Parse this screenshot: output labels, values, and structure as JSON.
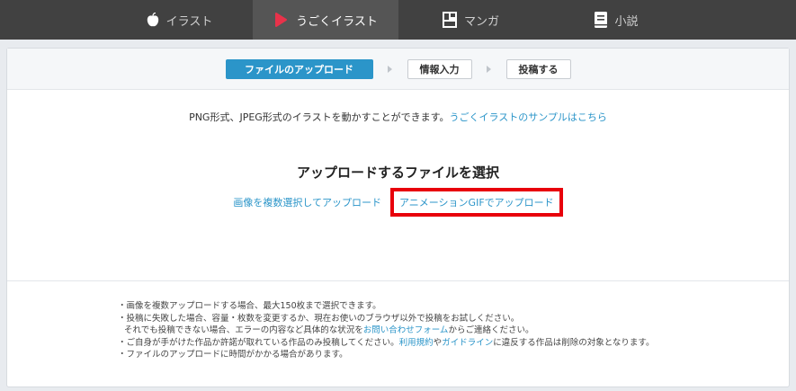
{
  "tabs": [
    {
      "label": "イラスト",
      "icon": "apple-icon"
    },
    {
      "label": "うごくイラスト",
      "icon": "play-icon"
    },
    {
      "label": "マンガ",
      "icon": "manga-icon"
    },
    {
      "label": "小説",
      "icon": "book-icon"
    }
  ],
  "steps": {
    "upload": "ファイルのアップロード",
    "info": "情報入力",
    "post": "投稿する"
  },
  "intro": {
    "text": "PNG形式、JPEG形式のイラストを動かすことができます。",
    "link": "うごくイラストのサンプルはこちら"
  },
  "heading": "アップロードするファイルを選択",
  "options": {
    "multi": "画像を複数選択してアップロード",
    "gif": "アニメーションGIFでアップロード"
  },
  "notes": {
    "line1": "・画像を複数アップロードする場合、最大150枚まで選択できます。",
    "line2": "・投稿に失敗した場合、容量・枚数を変更するか、現在お使いのブラウザ以外で投稿をお試しください。",
    "line3_pre": "それでも投稿できない場合、エラーの内容など具体的な状況を",
    "line3_link": "お問い合わせフォーム",
    "line3_post": "からご連絡ください。",
    "line4_pre": "・ご自身が手がけた作品か許諾が取れている作品のみ投稿してください。",
    "line4_link1": "利用規約",
    "line4_mid": "や",
    "line4_link2": "ガイドライン",
    "line4_post": "に違反する作品は削除の対象となります。",
    "line5": "・ファイルのアップロードに時間がかかる場合があります。"
  },
  "colors": {
    "accent": "#2b95c9",
    "highlight": "#e8000b",
    "play": "#e8324a"
  }
}
